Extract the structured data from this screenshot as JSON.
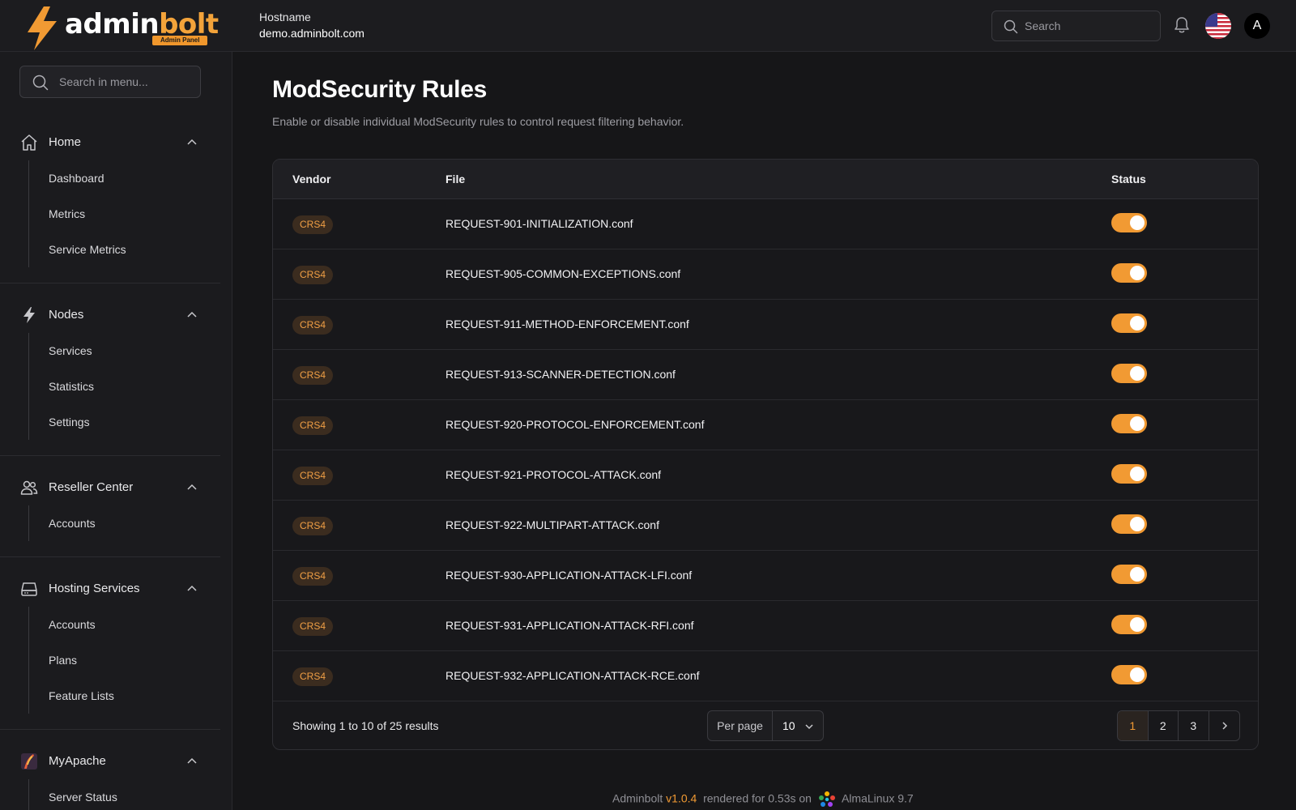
{
  "brand": {
    "name_a": "admin",
    "name_b": "bolt",
    "tag": "Admin Panel"
  },
  "host": {
    "label": "Hostname",
    "value": "demo.adminbolt.com"
  },
  "top_search": {
    "placeholder": "Search"
  },
  "user": {
    "initial": "A"
  },
  "menu_search": {
    "placeholder": "Search in menu..."
  },
  "sidebar": {
    "groups": [
      {
        "title": "Home",
        "icon": "home-icon",
        "items": [
          "Dashboard",
          "Metrics",
          "Service Metrics"
        ]
      },
      {
        "title": "Nodes",
        "icon": "bolt-icon",
        "items": [
          "Services",
          "Statistics",
          "Settings"
        ]
      },
      {
        "title": "Reseller Center",
        "icon": "users-icon",
        "items": [
          "Accounts"
        ]
      },
      {
        "title": "Hosting Services",
        "icon": "server-icon",
        "items": [
          "Accounts",
          "Plans",
          "Feature Lists"
        ]
      },
      {
        "title": "MyApache",
        "icon": "apache-feather-icon",
        "items": [
          "Server Status"
        ]
      }
    ]
  },
  "page": {
    "title": "ModSecurity Rules",
    "description": "Enable or disable individual ModSecurity rules to control request filtering behavior."
  },
  "table": {
    "headers": {
      "vendor": "Vendor",
      "file": "File",
      "status": "Status"
    },
    "rows": [
      {
        "vendor": "CRS4",
        "file": "REQUEST-901-INITIALIZATION.conf",
        "enabled": true
      },
      {
        "vendor": "CRS4",
        "file": "REQUEST-905-COMMON-EXCEPTIONS.conf",
        "enabled": true
      },
      {
        "vendor": "CRS4",
        "file": "REQUEST-911-METHOD-ENFORCEMENT.conf",
        "enabled": true
      },
      {
        "vendor": "CRS4",
        "file": "REQUEST-913-SCANNER-DETECTION.conf",
        "enabled": true
      },
      {
        "vendor": "CRS4",
        "file": "REQUEST-920-PROTOCOL-ENFORCEMENT.conf",
        "enabled": true
      },
      {
        "vendor": "CRS4",
        "file": "REQUEST-921-PROTOCOL-ATTACK.conf",
        "enabled": true
      },
      {
        "vendor": "CRS4",
        "file": "REQUEST-922-MULTIPART-ATTACK.conf",
        "enabled": true
      },
      {
        "vendor": "CRS4",
        "file": "REQUEST-930-APPLICATION-ATTACK-LFI.conf",
        "enabled": true
      },
      {
        "vendor": "CRS4",
        "file": "REQUEST-931-APPLICATION-ATTACK-RFI.conf",
        "enabled": true
      },
      {
        "vendor": "CRS4",
        "file": "REQUEST-932-APPLICATION-ATTACK-RCE.conf",
        "enabled": true
      }
    ]
  },
  "pagination": {
    "showing": "Showing 1 to 10 of 25 results",
    "per_page_label": "Per page",
    "per_page_value": "10",
    "pages": [
      "1",
      "2",
      "3"
    ],
    "current": "1"
  },
  "footer": {
    "app": "Adminbolt",
    "version": "v1.0.4",
    "rendered": "rendered for 0.53s on",
    "os": "AlmaLinux 9.7"
  },
  "colors": {
    "accent": "#f19a33",
    "background": "#161618",
    "sidebar": "#1b1b1e"
  }
}
